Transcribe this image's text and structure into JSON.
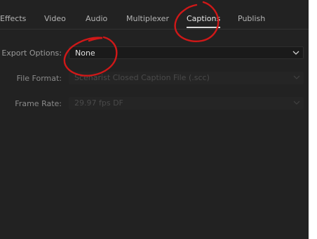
{
  "tabs": [
    {
      "label": "Effects",
      "active": false
    },
    {
      "label": "Video",
      "active": false
    },
    {
      "label": "Audio",
      "active": false
    },
    {
      "label": "Multiplexer",
      "active": false
    },
    {
      "label": "Captions",
      "active": true
    },
    {
      "label": "Publish",
      "active": false
    }
  ],
  "captions": {
    "export_options": {
      "label": "Export Options:",
      "value": "None",
      "enabled": true
    },
    "file_format": {
      "label": "File Format:",
      "value": "Scenarist Closed Caption File (.scc)",
      "enabled": false
    },
    "frame_rate": {
      "label": "Frame Rate:",
      "value": "29.97 fps DF",
      "enabled": false
    }
  },
  "icons": {
    "dropdown": "chevron-down-icon"
  },
  "colors": {
    "panel_background": "#222222",
    "annotation_red": "#d01818",
    "active_tab_underline": "#d8d8d8"
  }
}
